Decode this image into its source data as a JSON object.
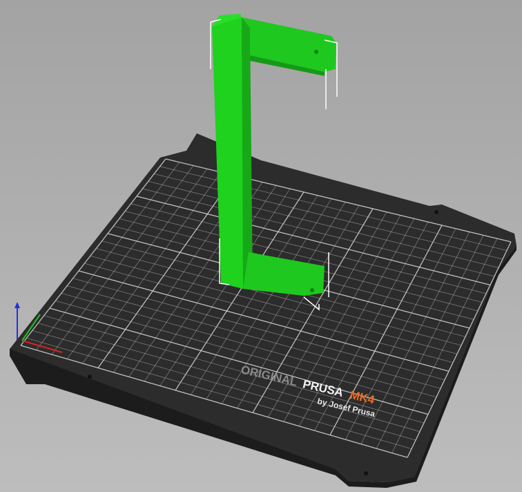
{
  "viewport": {
    "background": "#b0b0b0"
  },
  "bed": {
    "plate_color": "#2c2c2c",
    "grid_color": "#d8d8d8",
    "logo": {
      "original": "ORIGINAL",
      "prusa": "PRUSA",
      "model": "MK4",
      "byline": "by Josef Prusa",
      "model_color": "#ee6a1e"
    }
  },
  "object": {
    "color": "#1ec81e",
    "selected": true
  },
  "axes": {
    "x_color": "#e02020",
    "y_color": "#20c020",
    "z_color": "#2030e0"
  }
}
